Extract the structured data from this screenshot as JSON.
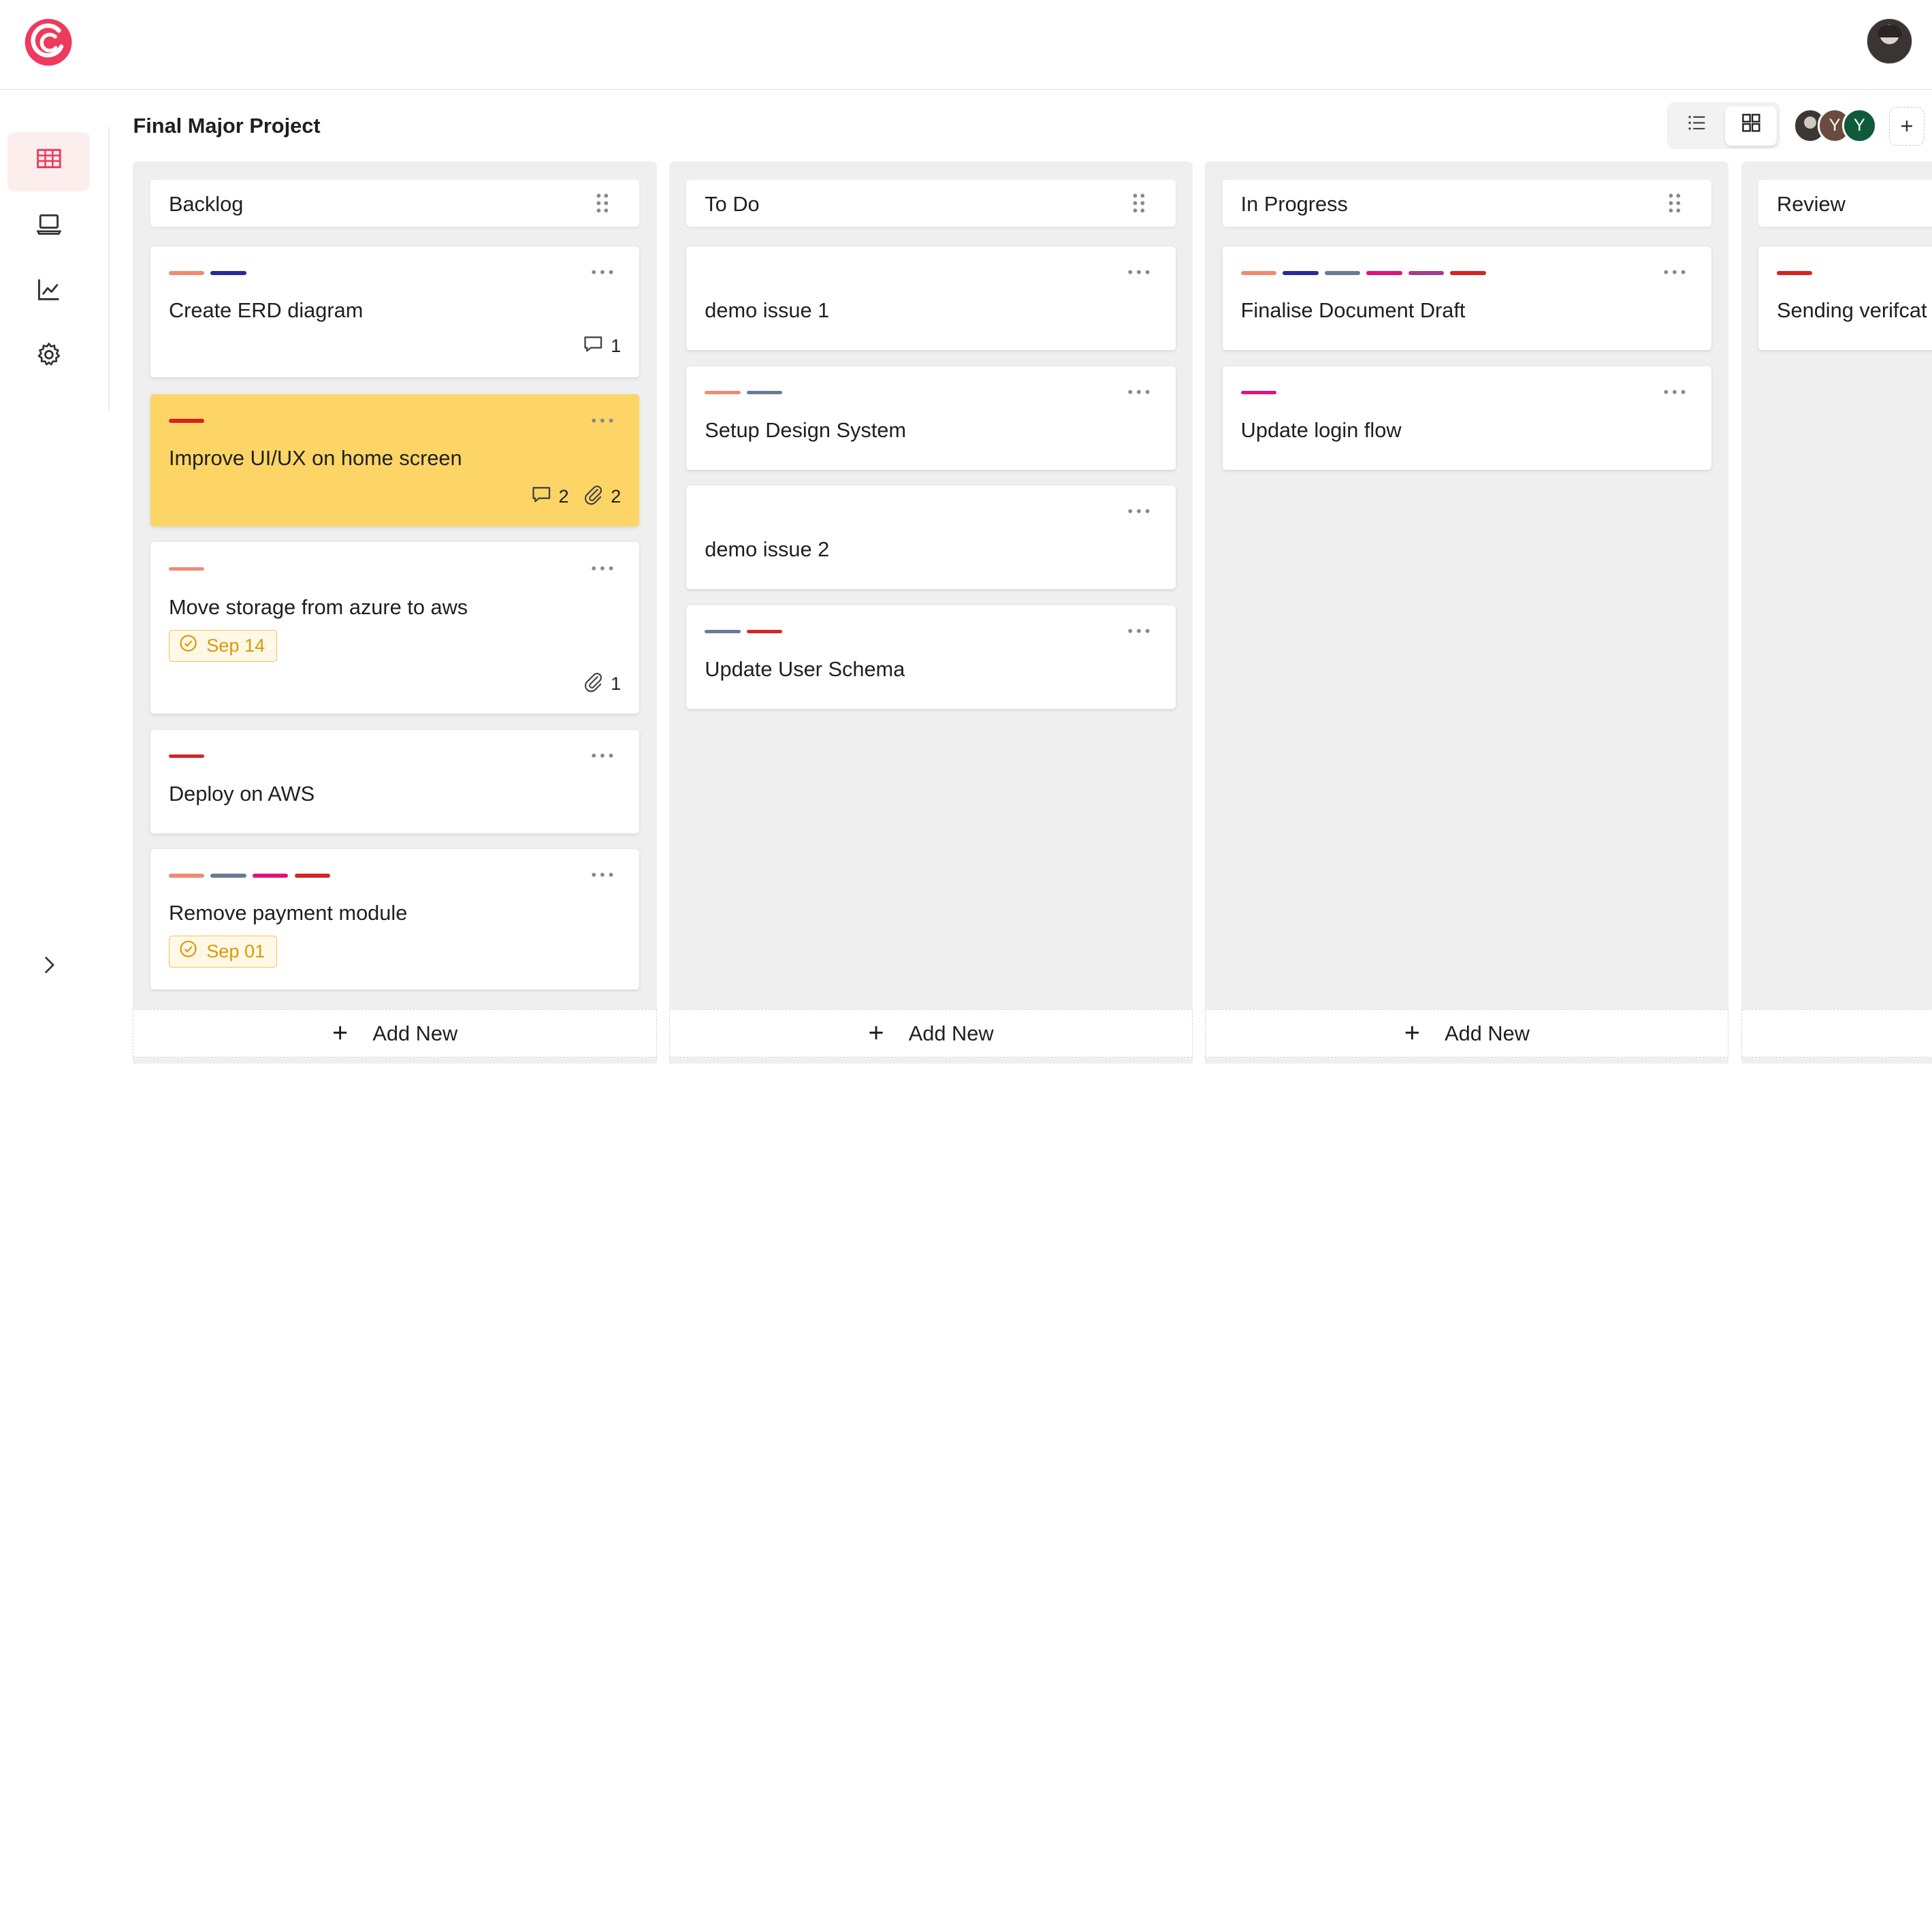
{
  "app": {
    "logo": "swirl-logo"
  },
  "header": {
    "user_avatar": "user-photo"
  },
  "sidebar": {
    "items": [
      {
        "icon": "table-icon",
        "active": true
      },
      {
        "icon": "laptop-icon",
        "active": false
      },
      {
        "icon": "chart-line-icon",
        "active": false
      },
      {
        "icon": "gear-icon",
        "active": false
      }
    ],
    "expand_icon": "chevron-right-icon"
  },
  "project": {
    "title": "Final Major Project",
    "view_modes": [
      "list",
      "board"
    ],
    "active_view": "board",
    "members": [
      {
        "initial": "",
        "color": "#3c3634"
      },
      {
        "initial": "Y",
        "color": "#6b4a3f"
      },
      {
        "initial": "Y",
        "color": "#0f5a3a"
      }
    ],
    "add_member_label": "+"
  },
  "colors": {
    "salmon": "#f08a72",
    "navy": "#2a2a9a",
    "slate": "#6b7a94",
    "pink": "#e0147a",
    "purple": "#a0408c",
    "red": "#d42424",
    "highlight": "#fdd566",
    "due": "#d99a05"
  },
  "columns": [
    {
      "title": "Backlog",
      "add_label": "Add New",
      "cards": [
        {
          "title": "Create ERD diagram",
          "labels": [
            "#f08a72",
            "#2a2a9a"
          ],
          "comments": "1"
        },
        {
          "title": "Improve UI/UX on home screen",
          "labels": [
            "#d42424"
          ],
          "comments": "2",
          "attachments": "2",
          "highlight": true
        },
        {
          "title": "Move storage from azure to aws",
          "labels": [
            "#f08a72"
          ],
          "due": "Sep 14",
          "attachments": "1"
        },
        {
          "title": "Deploy on AWS",
          "labels": [
            "#d42424"
          ]
        },
        {
          "title": "Remove payment module",
          "labels": [
            "#f08a72",
            "#6b7a94",
            "#e0147a",
            "#d42424"
          ],
          "due": "Sep 01"
        }
      ]
    },
    {
      "title": "To Do",
      "add_label": "Add New",
      "cards": [
        {
          "title": "demo issue 1",
          "labels": []
        },
        {
          "title": "Setup Design System",
          "labels": [
            "#f08a72",
            "#6b7a94"
          ]
        },
        {
          "title": "demo issue 2",
          "labels": []
        },
        {
          "title": "Update User Schema",
          "labels": [
            "#6b7a94",
            "#d42424"
          ]
        }
      ]
    },
    {
      "title": "In Progress",
      "add_label": "Add New",
      "cards": [
        {
          "title": "Finalise Document Draft",
          "labels": [
            "#f08a72",
            "#2a2a9a",
            "#6b7a94",
            "#e0147a",
            "#a0408c",
            "#d42424"
          ]
        },
        {
          "title": "Update login flow",
          "labels": [
            "#e0147a"
          ]
        }
      ]
    },
    {
      "title": "Review",
      "add_label": "",
      "cards": [
        {
          "title": "Sending verifcat",
          "labels": [
            "#d42424"
          ]
        }
      ]
    }
  ]
}
